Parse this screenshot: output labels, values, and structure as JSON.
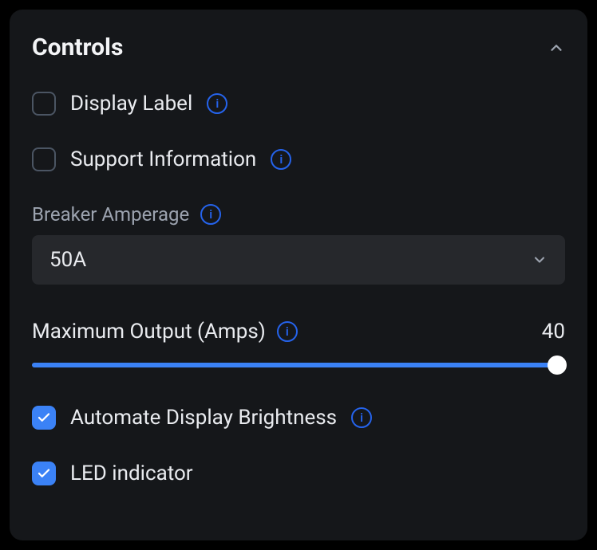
{
  "panel": {
    "title": "Controls"
  },
  "controls": {
    "displayLabel": {
      "label": "Display Label",
      "checked": false
    },
    "supportInfo": {
      "label": "Support Information",
      "checked": false
    },
    "breakerAmperage": {
      "label": "Breaker Amperage",
      "value": "50A"
    },
    "maxOutput": {
      "label": "Maximum Output (Amps)",
      "value": "40"
    },
    "autoBrightness": {
      "label": "Automate Display Brightness",
      "checked": true
    },
    "ledIndicator": {
      "label": "LED indicator",
      "checked": true
    }
  }
}
